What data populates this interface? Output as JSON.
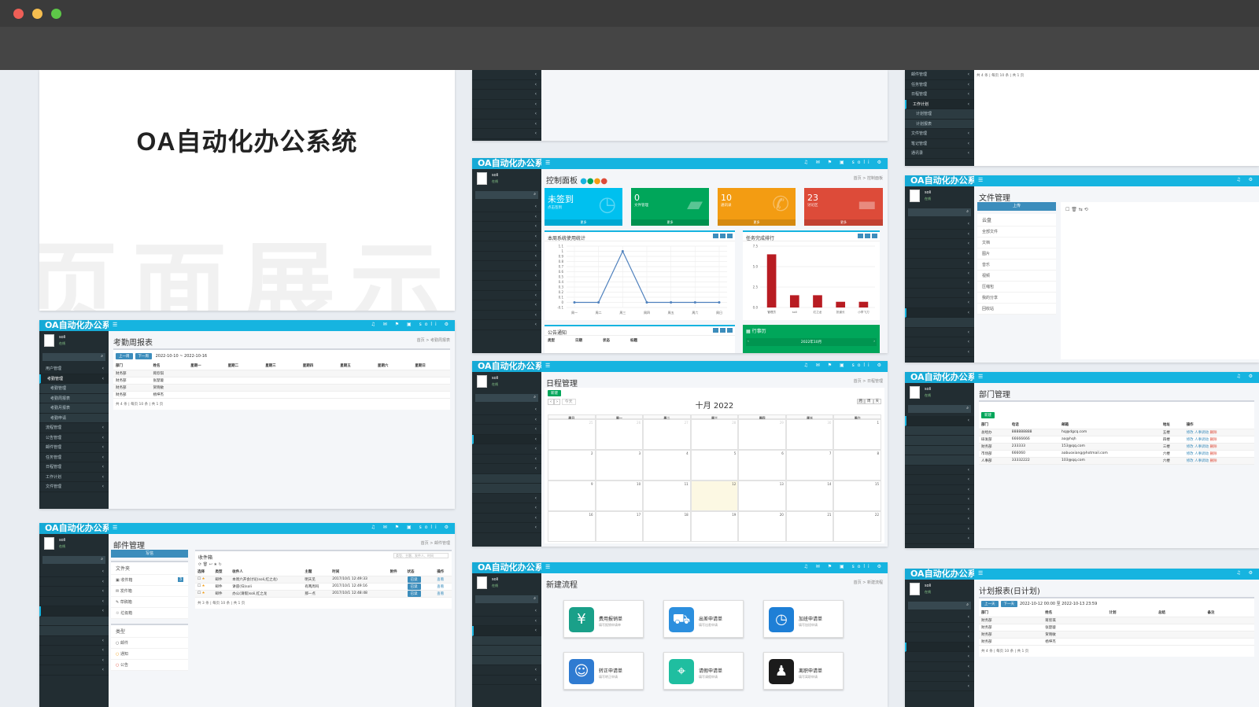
{
  "window": {
    "controls": {
      "close": "#ee5f57",
      "minimize": "#f6be4f",
      "zoom": "#5dc848"
    }
  },
  "cover": {
    "title": "OA自动化办公系统",
    "watermark": "页面展示"
  },
  "app": {
    "logo": "OA自动化办公系统",
    "user_name": "soli",
    "user_status": "在线",
    "search_placeholder": "搜索...",
    "accent": "#16b4e0"
  },
  "attendance": {
    "title": "考勤周报表",
    "breadcrumb": "首页 > 考勤周报表",
    "prev_btn": "上一周",
    "next_btn": "下一周",
    "range_start": "2022-10-10",
    "range_end": "2022-10-16",
    "columns": [
      "部门",
      "姓名",
      "星期一",
      "星期二",
      "星期三",
      "星期四",
      "星期五",
      "星期六",
      "星期日"
    ],
    "rows": [
      [
        "财务部",
        "蒋欣琪"
      ],
      [
        "财务部",
        "张楚璇"
      ],
      [
        "财务部",
        "贺晓敏"
      ],
      [
        "财务部",
        "杨坤杰"
      ]
    ],
    "pager": "共 4 条 | 每页 10 条 | 共 1 页",
    "menu": [
      "用户管理",
      "考勤管理",
      "考勤管理",
      "考勤周报表",
      "考勤月报表",
      "考勤申请",
      "流程管理",
      "公告管理",
      "邮件管理",
      "任务管理",
      "日程管理",
      "工作计划",
      "文件管理"
    ]
  },
  "mail": {
    "title": "邮件管理",
    "breadcrumb": "首页 > 邮件管理",
    "compose_btn": "写信",
    "inbox_title": "收件箱",
    "search_placeholder": "类型、主题、发件人、时间",
    "folders_title": "文件夹",
    "folders": [
      {
        "name": "收件箱",
        "count": "3"
      },
      {
        "name": "发件箱"
      },
      {
        "name": "草稿箱"
      },
      {
        "name": "垃圾箱"
      }
    ],
    "types_title": "类型",
    "types": [
      "邮件",
      "通知",
      "公告"
    ],
    "columns": [
      "选择",
      "类型",
      "收件人",
      "主题",
      "时间",
      "附件",
      "状态",
      "操作"
    ],
    "rows": [
      {
        "type": "邮件",
        "to": "本周六开会讨论(soli,红之龙)",
        "subject": "明天见",
        "time": "2017/10/1 12:49:33",
        "status": "已读",
        "op": "查看"
      },
      {
        "type": "邮件",
        "to": "讲座(归)soli",
        "subject": "有两周吗",
        "time": "2017/10/1 12:49:16",
        "status": "已读",
        "op": "查看"
      },
      {
        "type": "邮件",
        "to": "办公(请假)soli,红之龙",
        "subject": "那一点",
        "time": "2017/10/1 12:48:48",
        "status": "已读",
        "op": "查看"
      }
    ],
    "pager": "共 3 条 | 每页 10 条 | 共 1 页"
  },
  "dashboard": {
    "title": "控制面板",
    "breadcrumb": "首页 > 控制面板",
    "cards": [
      {
        "value": "未签到",
        "desc": "点击签到",
        "footer": "更多",
        "color": "#00c0ef",
        "icon": "clock-icon"
      },
      {
        "value": "0",
        "desc": "文件管理",
        "footer": "更多",
        "color": "#00a65a",
        "icon": "folder-icon"
      },
      {
        "value": "10",
        "desc": "通讯录",
        "footer": "更多",
        "color": "#f39c12",
        "icon": "phone-icon"
      },
      {
        "value": "23",
        "desc": "讨论区",
        "footer": "更多",
        "color": "#dd4b39",
        "icon": "chat-icon"
      }
    ],
    "line_panel_title": "本周系统使用统计",
    "bar_panel_title": "任务完成排行",
    "notice_panel_title": "公告通知",
    "notice_columns": [
      "类型",
      "日期",
      "状态",
      "标题"
    ],
    "schedule_panel_title": "行事历",
    "schedule_month": "2022年10月"
  },
  "schedule": {
    "title": "日程管理",
    "breadcrumb": "首页 > 日程管理",
    "new_btn": "新建",
    "today_btn": "今天",
    "month_label": "十月 2022",
    "views": [
      "月",
      "周",
      "天"
    ],
    "weekdays": [
      "周日",
      "周一",
      "周二",
      "周三",
      "周四",
      "周五",
      "周六"
    ],
    "weeks": [
      [
        "25",
        "26",
        "27",
        "28",
        "29",
        "30",
        "1"
      ],
      [
        "2",
        "3",
        "4",
        "5",
        "6",
        "7",
        "8"
      ],
      [
        "9",
        "10",
        "11",
        "12",
        "13",
        "14",
        "15"
      ],
      [
        "16",
        "17",
        "18",
        "19",
        "20",
        "21",
        "22"
      ]
    ],
    "today": "12"
  },
  "newflow": {
    "title": "新建流程",
    "breadcrumb": "首页 > 新建流程",
    "items": [
      {
        "name": "费用报销单",
        "desc": "填写报销申请单",
        "color": "#1aa089",
        "icon": "money-icon"
      },
      {
        "name": "出差申请单",
        "desc": "填写出差申请",
        "color": "#2c8fde",
        "icon": "car-icon"
      },
      {
        "name": "加班申请单",
        "desc": "填写加班申请",
        "color": "#1e7fd6",
        "icon": "clock-icon"
      },
      {
        "name": "转正申请单",
        "desc": "填写转正申请",
        "color": "#2f7bd1",
        "icon": "id-card-icon"
      },
      {
        "name": "请假申请单",
        "desc": "填写请假申请",
        "color": "#1fbea0",
        "icon": "location-icon"
      },
      {
        "name": "离职申请单",
        "desc": "填写离职申请",
        "color": "#1b1b1b",
        "icon": "person-icon"
      }
    ]
  },
  "topright": {
    "pager": "共 4 条 | 每页 10 条 | 共 1 页",
    "menu": [
      "邮件管理",
      "任务管理",
      "日程管理",
      "工作计划",
      "计划管理",
      "计划报表",
      "文件管理",
      "笔记管理",
      "通讯录"
    ]
  },
  "files": {
    "title": "文件管理",
    "upload_btn": "上传",
    "tree_root": "云盘",
    "tree": [
      "全部文件",
      "文档",
      "图片",
      "音乐",
      "视频",
      "压缩包",
      "我的分享",
      "回收站"
    ]
  },
  "dept": {
    "title": "部门管理",
    "new_btn": "新建",
    "columns": [
      "部门",
      "电话",
      "邮箱",
      "地址",
      "操作"
    ],
    "rows": [
      {
        "name": "总经办",
        "phone": "888888888",
        "email": "hq@dgcq.com",
        "addr": "五楼"
      },
      {
        "name": "研发部",
        "phone": "66666666",
        "email": "aa@hqh",
        "addr": "四楼"
      },
      {
        "name": "财务部",
        "phone": "233333",
        "email": "153@qq.com",
        "addr": "三楼"
      },
      {
        "name": "市场部",
        "phone": "666060",
        "email": "aabuoxiang@hotmail.com",
        "addr": "六楼"
      },
      {
        "name": "人事部",
        "phone": "33332222",
        "email": "103@qq.com",
        "addr": "六楼"
      }
    ],
    "actions": [
      "修改",
      "人事调动",
      "删除"
    ]
  },
  "plan": {
    "title": "计划报表(日计划)",
    "prev_btn": "上一天",
    "next_btn": "下一天",
    "range": "2022-10-12 00:00 至 2022-10-13 23:59",
    "columns": [
      "部门",
      "姓名",
      "计划",
      "总结",
      "备注"
    ],
    "rows": [
      [
        "财务部",
        "蒋欣琪"
      ],
      [
        "财务部",
        "张楚璇"
      ],
      [
        "财务部",
        "贺晓敏"
      ],
      [
        "财务部",
        "杨坤杰"
      ]
    ],
    "pager": "共 4 条 | 每页 10 条 | 共 1 页"
  },
  "chart_data": [
    {
      "type": "line",
      "title": "本周系统使用统计",
      "categories": [
        "周一",
        "周二",
        "周三",
        "周四",
        "周五",
        "周六",
        "周日"
      ],
      "values": [
        0,
        0,
        1,
        0,
        0,
        0,
        0
      ],
      "ylim": [
        -0.1,
        1.1
      ],
      "yticks": [
        "1.1",
        "1",
        "0.9",
        "0.8",
        "0.7",
        "0.6",
        "0.5",
        "0.4",
        "0.3",
        "0.2",
        "0.1",
        "0",
        "-0.1"
      ],
      "color": "#4f81bd",
      "grid": true
    },
    {
      "type": "bar",
      "title": "任务完成排行",
      "categories": [
        "管理员",
        "soli",
        "红之龙",
        "张道长",
        "小李飞刀"
      ],
      "values": [
        6.5,
        1.5,
        1.5,
        0.7,
        0.7
      ],
      "ylim": [
        0,
        7.5
      ],
      "yticks": [
        "7.5",
        "5.0",
        "2.5",
        "0.0"
      ],
      "color": "#b81c22",
      "grid": true
    }
  ]
}
